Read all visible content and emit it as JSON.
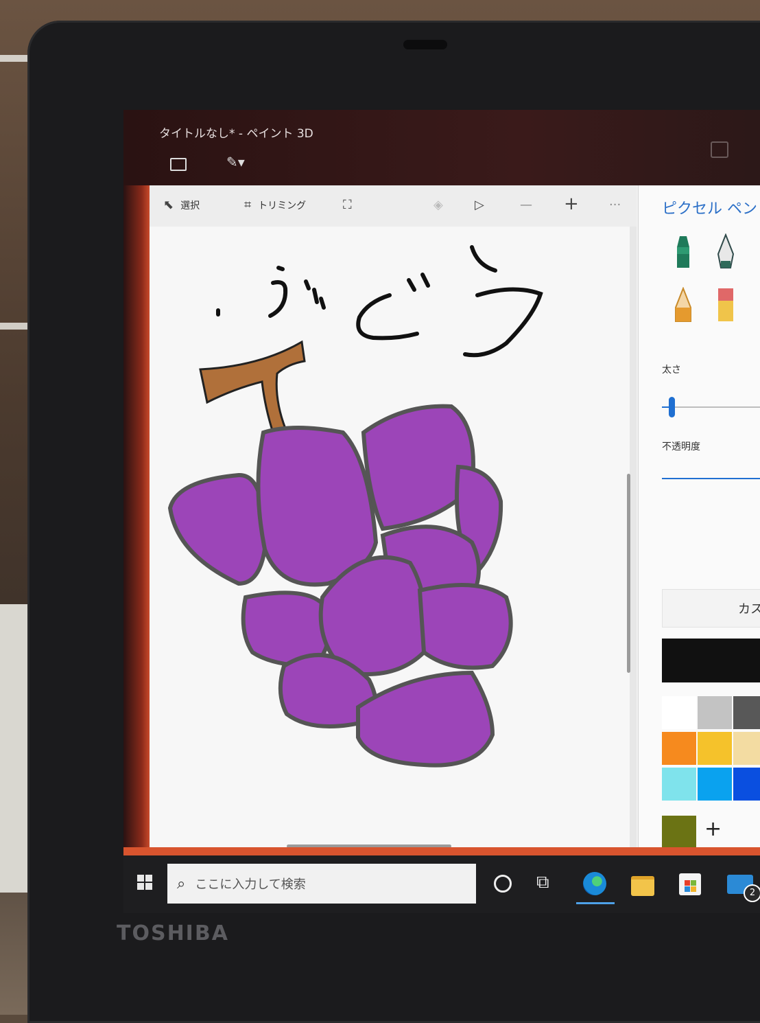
{
  "window": {
    "title": "タイトルなし* - ペイント 3D"
  },
  "toolbar": {
    "select_label": "選択",
    "crop_label": "トリミング",
    "zoom_out_label": "—",
    "zoom_in_label": "+",
    "more_label": "···"
  },
  "canvas": {
    "handwritten_text": "ぶどう"
  },
  "panel": {
    "title": "ピクセル ペン",
    "thickness_label": "太さ",
    "opacity_label": "不透明度",
    "custom_label": "カスタム",
    "current_color": "#111111",
    "custom_swatch_color": "#6b7314",
    "brushes": [
      {
        "name": "marker",
        "color": "#1f7a5a"
      },
      {
        "name": "calligraphy-pen",
        "color": "#2f6a5a"
      },
      {
        "name": "oil-brush",
        "color": "#e9b23a"
      },
      {
        "name": "pencil",
        "color": "#e59a2e"
      },
      {
        "name": "eraser",
        "color": "#e06868"
      },
      {
        "name": "crayon",
        "color": "#d9303a"
      }
    ],
    "palette": [
      "#ffffff",
      "#c3c3c3",
      "#585858",
      "#141414",
      "#f68a1e",
      "#f5c22b",
      "#f3dca2",
      "#f6d41d",
      "#7fe3ec",
      "#0aa2ef",
      "#0a4fe0",
      "#8a40c0"
    ]
  },
  "taskbar": {
    "search_placeholder": "ここに入力して検索",
    "mail_badge": "2"
  },
  "device": {
    "brand": "TOSHIBA"
  }
}
